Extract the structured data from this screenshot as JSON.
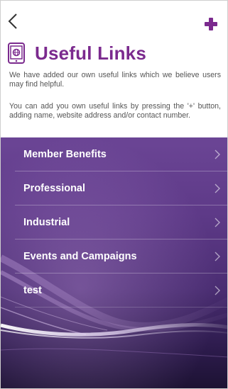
{
  "header": {
    "back_icon": "chevron-left-icon",
    "add_icon": "plus-icon",
    "title": "Useful Links",
    "title_icon": "phone-link-icon"
  },
  "intro": {
    "paragraph_1": "We have added our own useful links which we believe users may find helpful.",
    "paragraph_2": "You can add you own useful links by pressing the '+' button, adding name, website address and/or contact number."
  },
  "links": [
    {
      "label": "Member Benefits"
    },
    {
      "label": "Professional"
    },
    {
      "label": "Industrial"
    },
    {
      "label": "Events and Campaigns"
    },
    {
      "label": "test"
    }
  ],
  "colors": {
    "accent": "#7b2a8e",
    "text_muted": "#555555",
    "list_background_top": "#6b4595",
    "list_background_bottom": "#1c1232"
  }
}
